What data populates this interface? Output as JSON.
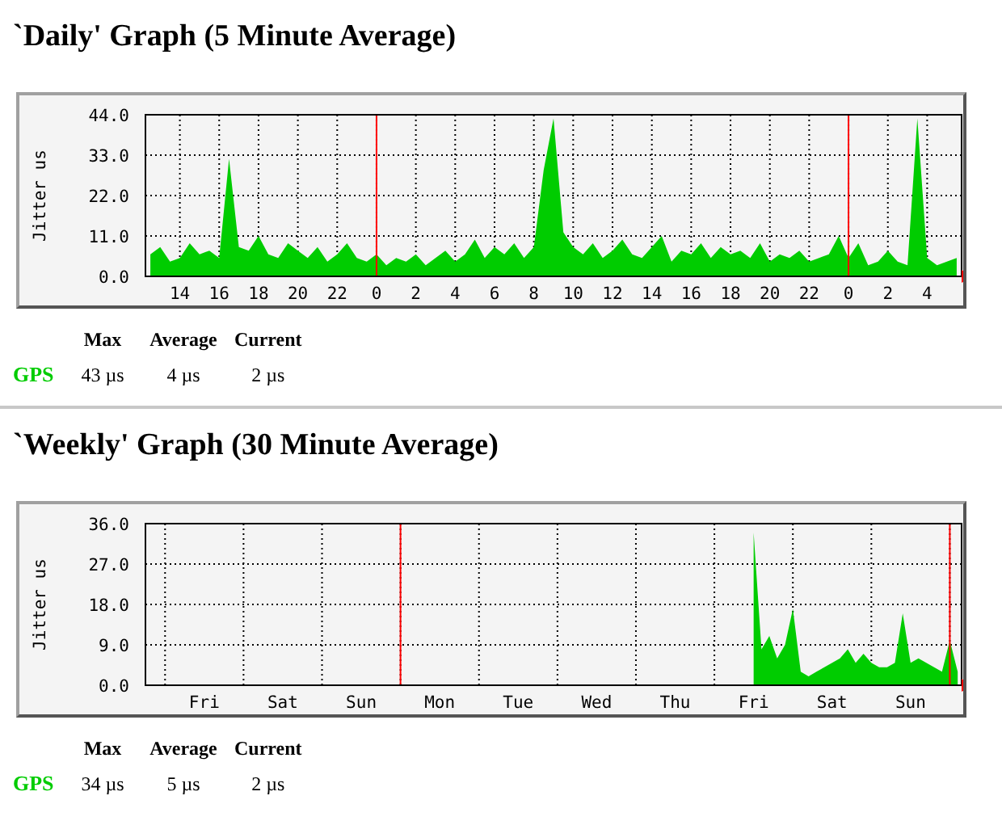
{
  "sections": [
    {
      "title": "`Daily' Graph (5 Minute Average)",
      "kind": "hours",
      "chart_data": {
        "type": "area",
        "ylabel": "Jitter us",
        "grid": true,
        "ylim": [
          0,
          44
        ],
        "yticks": [
          {
            "value": 0,
            "label": "0.0"
          },
          {
            "value": 11,
            "label": "11.0"
          },
          {
            "value": 22,
            "label": "22.0"
          },
          {
            "value": 33,
            "label": "33.0"
          },
          {
            "value": 44,
            "label": "44.0"
          }
        ],
        "categories": [
          null,
          null,
          null,
          "14",
          null,
          null,
          null,
          "16",
          null,
          null,
          null,
          "18",
          null,
          null,
          null,
          "20",
          null,
          null,
          null,
          "22",
          null,
          null,
          null,
          "0",
          null,
          null,
          null,
          "2",
          null,
          null,
          null,
          "4",
          null,
          null,
          null,
          "6",
          null,
          null,
          null,
          "8",
          null,
          null,
          null,
          "10",
          null,
          null,
          null,
          "12",
          null,
          null,
          null,
          "14",
          null,
          null,
          null,
          "16",
          null,
          null,
          null,
          "18",
          null,
          null,
          null,
          "20",
          null,
          null,
          null,
          "22",
          null,
          null,
          null,
          "0",
          null,
          null,
          null,
          "2",
          null,
          null,
          null,
          "4",
          null,
          null,
          null
        ],
        "series": [
          {
            "name": "GPS",
            "color": "#00cc00",
            "values": [
              6,
              8,
              4,
              5,
              9,
              6,
              7,
              5,
              32,
              8,
              7,
              11,
              6,
              5,
              9,
              7,
              5,
              8,
              4,
              6,
              9,
              5,
              4,
              6,
              3,
              5,
              4,
              6,
              3,
              5,
              7,
              4,
              6,
              10,
              5,
              8,
              6,
              9,
              5,
              8,
              29,
              43,
              12,
              8,
              6,
              9,
              5,
              7,
              10,
              6,
              5,
              8,
              11,
              4,
              7,
              6,
              9,
              5,
              8,
              6,
              7,
              5,
              9,
              4,
              6,
              5,
              7,
              4,
              5,
              6,
              11,
              5,
              9,
              3,
              4,
              7,
              4,
              3,
              43,
              5,
              3,
              4,
              5
            ]
          }
        ]
      },
      "legend": {
        "columns": [
          "Max",
          "Average",
          "Current"
        ],
        "rows": [
          {
            "values": [
              "43 µs",
              "4 µs",
              "2 µs"
            ]
          }
        ]
      }
    },
    {
      "title": "`Weekly' Graph (30 Minute Average)",
      "kind": "days",
      "chart_data": {
        "type": "area",
        "ylabel": "Jitter us",
        "grid": true,
        "ylim": [
          0,
          36
        ],
        "yticks": [
          {
            "value": 0,
            "label": "0.0"
          },
          {
            "value": 9,
            "label": "9.0"
          },
          {
            "value": 18,
            "label": "18.0"
          },
          {
            "value": 27,
            "label": "27.0"
          },
          {
            "value": 36,
            "label": "36.0"
          }
        ],
        "categories": [
          null,
          null,
          null,
          null,
          null,
          null,
          null,
          "Fri",
          null,
          null,
          null,
          null,
          null,
          null,
          null,
          null,
          null,
          "Sat",
          null,
          null,
          null,
          null,
          null,
          null,
          null,
          null,
          null,
          "Sun",
          null,
          null,
          null,
          null,
          null,
          null,
          null,
          null,
          null,
          "Mon",
          null,
          null,
          null,
          null,
          null,
          null,
          null,
          null,
          null,
          "Tue",
          null,
          null,
          null,
          null,
          null,
          null,
          null,
          null,
          null,
          "Wed",
          null,
          null,
          null,
          null,
          null,
          null,
          null,
          null,
          null,
          "Thu",
          null,
          null,
          null,
          null,
          null,
          null,
          null,
          null,
          null,
          "Fri",
          null,
          null,
          null,
          null,
          null,
          null,
          null,
          null,
          null,
          "Sat",
          null,
          null,
          null,
          null,
          null,
          null,
          null,
          null,
          null,
          "Sun",
          null,
          null,
          null,
          null,
          null,
          null
        ],
        "series": [
          {
            "name": "GPS",
            "color": "#00cc00",
            "values": [
              null,
              null,
              null,
              null,
              null,
              null,
              null,
              null,
              null,
              null,
              null,
              null,
              null,
              null,
              null,
              null,
              null,
              null,
              null,
              null,
              null,
              null,
              null,
              null,
              null,
              null,
              null,
              null,
              null,
              null,
              null,
              null,
              null,
              null,
              null,
              null,
              null,
              null,
              null,
              null,
              null,
              null,
              null,
              null,
              null,
              null,
              null,
              null,
              null,
              null,
              null,
              null,
              null,
              null,
              null,
              null,
              null,
              null,
              null,
              null,
              null,
              null,
              null,
              null,
              null,
              null,
              null,
              null,
              null,
              null,
              null,
              null,
              null,
              null,
              null,
              null,
              null,
              34,
              8,
              11,
              6,
              9,
              17,
              3,
              2,
              3,
              4,
              5,
              6,
              8,
              5,
              7,
              5,
              4,
              4,
              5,
              16,
              5,
              6,
              5,
              4,
              3,
              10,
              3
            ]
          }
        ]
      },
      "legend": {
        "columns": [
          "Max",
          "Average",
          "Current"
        ],
        "rows": [
          {
            "values": [
              "34 µs",
              "5 µs",
              "2 µs"
            ]
          }
        ]
      }
    }
  ]
}
